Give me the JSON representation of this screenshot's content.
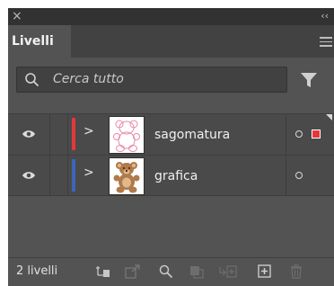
{
  "panel": {
    "close_glyph": "×",
    "collapse_glyph": "‹‹",
    "tab_label": "Livelli",
    "menu_icon": "hamburger-menu-icon"
  },
  "search": {
    "placeholder": "Cerca tutto",
    "icon": "search-icon",
    "filter_icon": "filter-icon"
  },
  "layers": [
    {
      "name": "sagomatura",
      "color": "#e2383c",
      "visible": true,
      "selected": true,
      "thumbnail": "teddy-bear-outline"
    },
    {
      "name": "grafica",
      "color": "#3f63b8",
      "visible": true,
      "selected": false,
      "thumbnail": "teddy-bear-filled"
    }
  ],
  "footer": {
    "count_label": "2 livelli",
    "icons": [
      "collect-for-export-icon",
      "export-icon",
      "locate-object-icon",
      "make-clipping-mask-icon",
      "new-sublayer-icon",
      "new-layer-icon",
      "delete-icon"
    ]
  }
}
